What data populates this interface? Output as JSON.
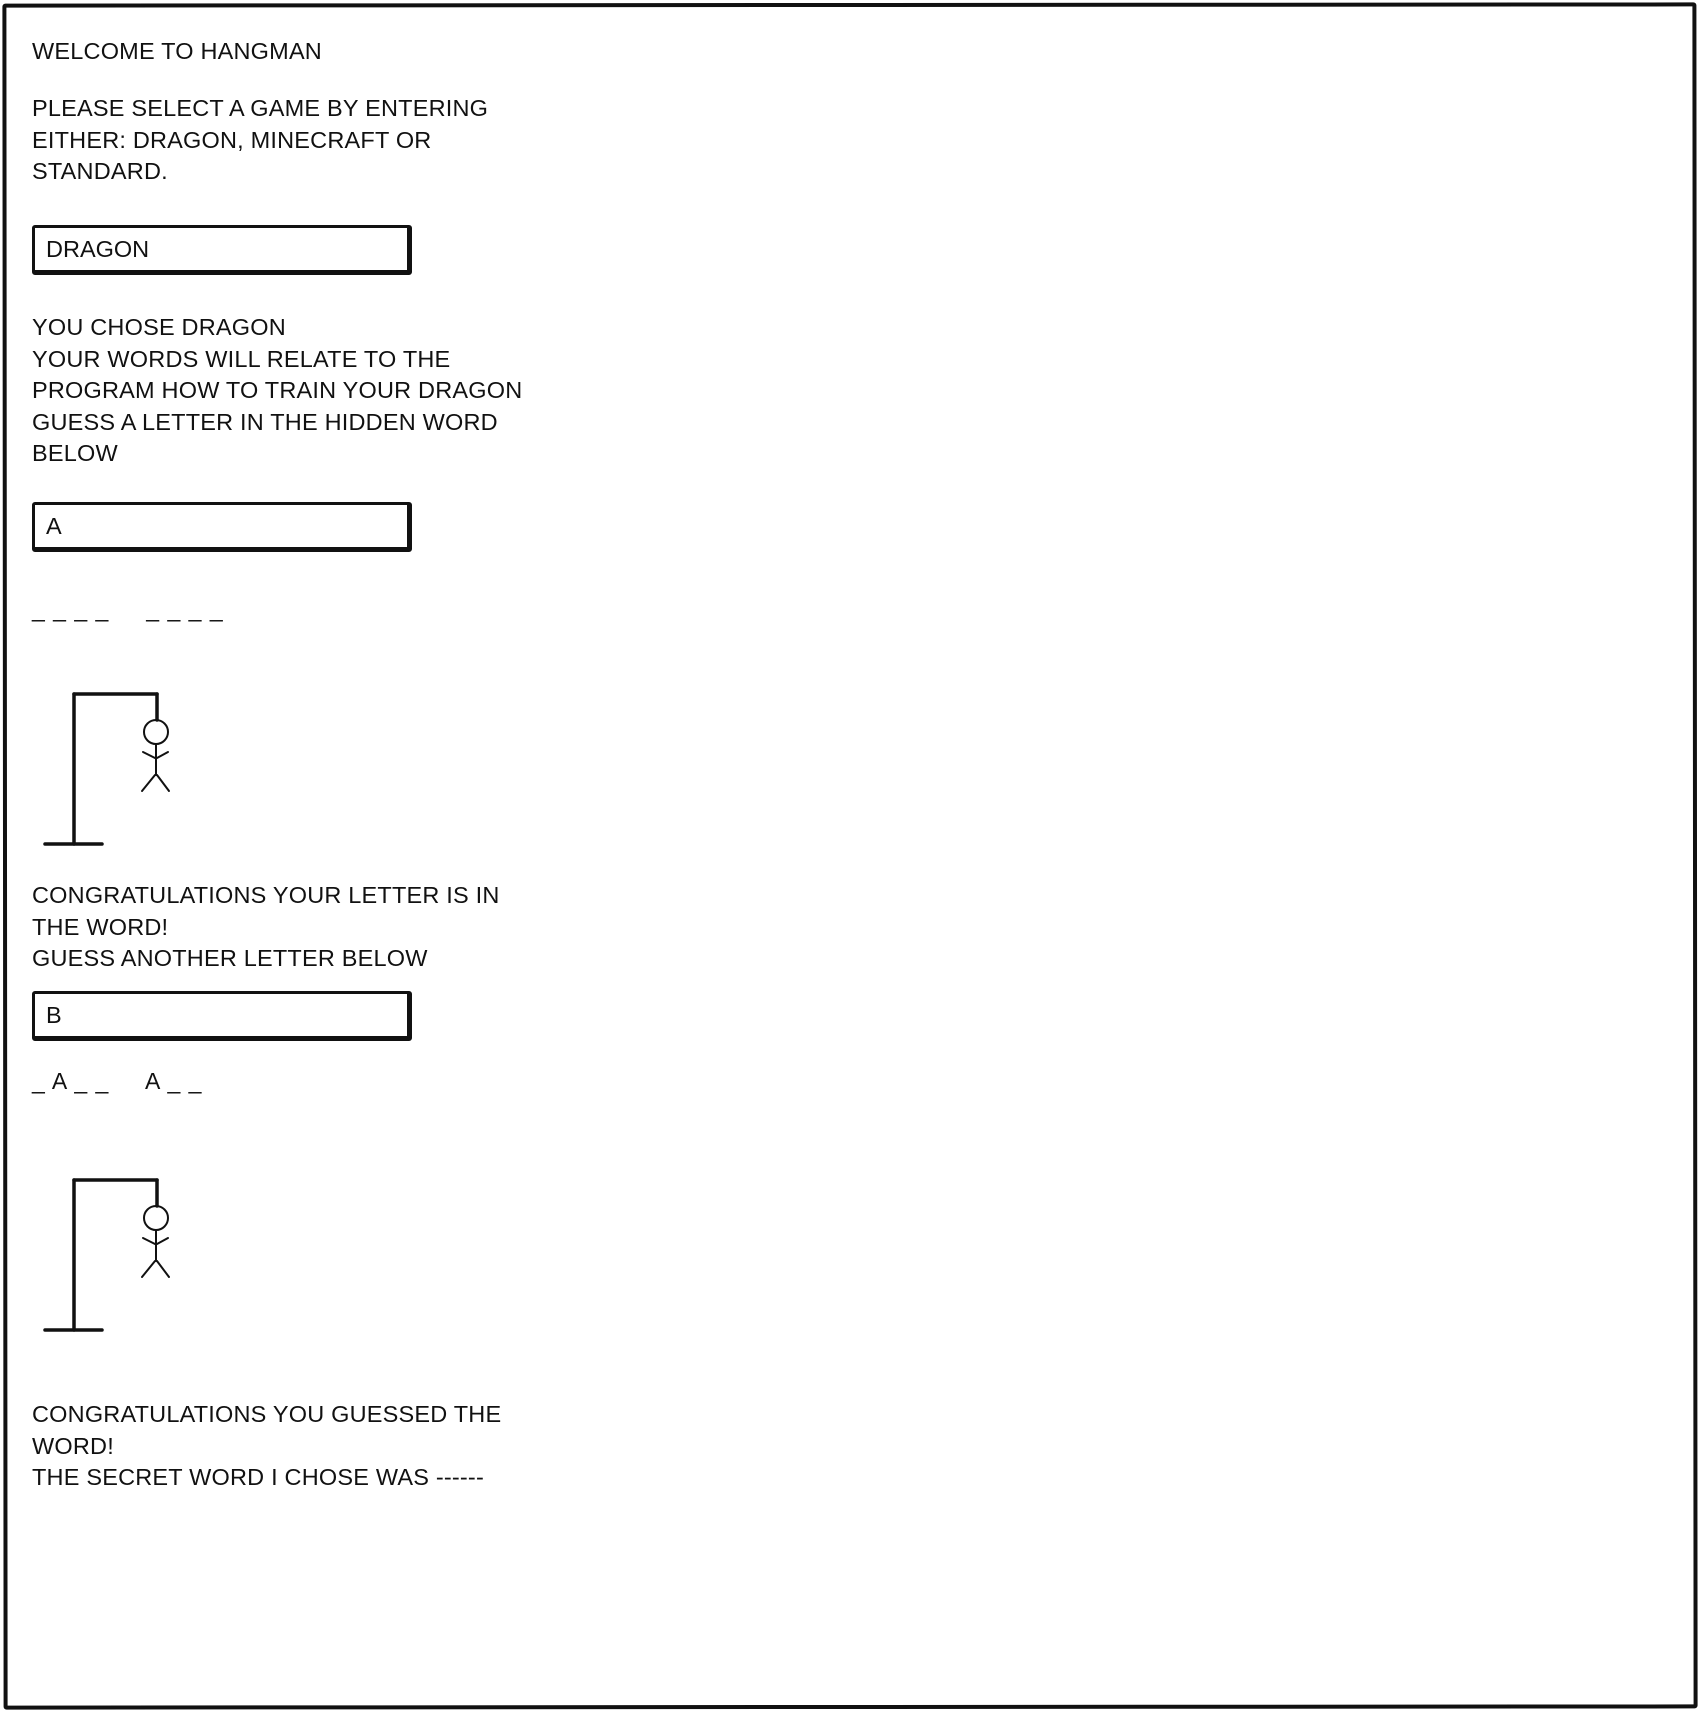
{
  "welcome": "WELCOME TO HANGMAN",
  "select_prompt": "PLEASE SELECT A GAME BY ENTERING\nEITHER: DRAGON, MINECRAFT OR\nSTANDARD.",
  "game_input_value": "DRAGON",
  "chose_message": "YOU CHOSE DRAGON\nYOUR WORDS WILL RELATE TO THE\nPROGRAM HOW TO TRAIN YOUR DRAGON\nGUESS A LETTER IN THE HIDDEN WORD\nBELOW",
  "letter_input_1_value": "A",
  "hidden_word_initial": "_ _ _ _     _ _ _ _",
  "correct_letter_message": "CONGRATULATIONS YOUR LETTER IS IN\nTHE WORD!\nGUESS ANOTHER LETTER BELOW",
  "letter_input_2_value": "B",
  "hidden_word_progress": "_ A _ _     A _ _",
  "win_message": "CONGRATULATIONS YOU GUESSED THE\nWORD!\nTHE SECRET WORD I CHOSE WAS ------"
}
